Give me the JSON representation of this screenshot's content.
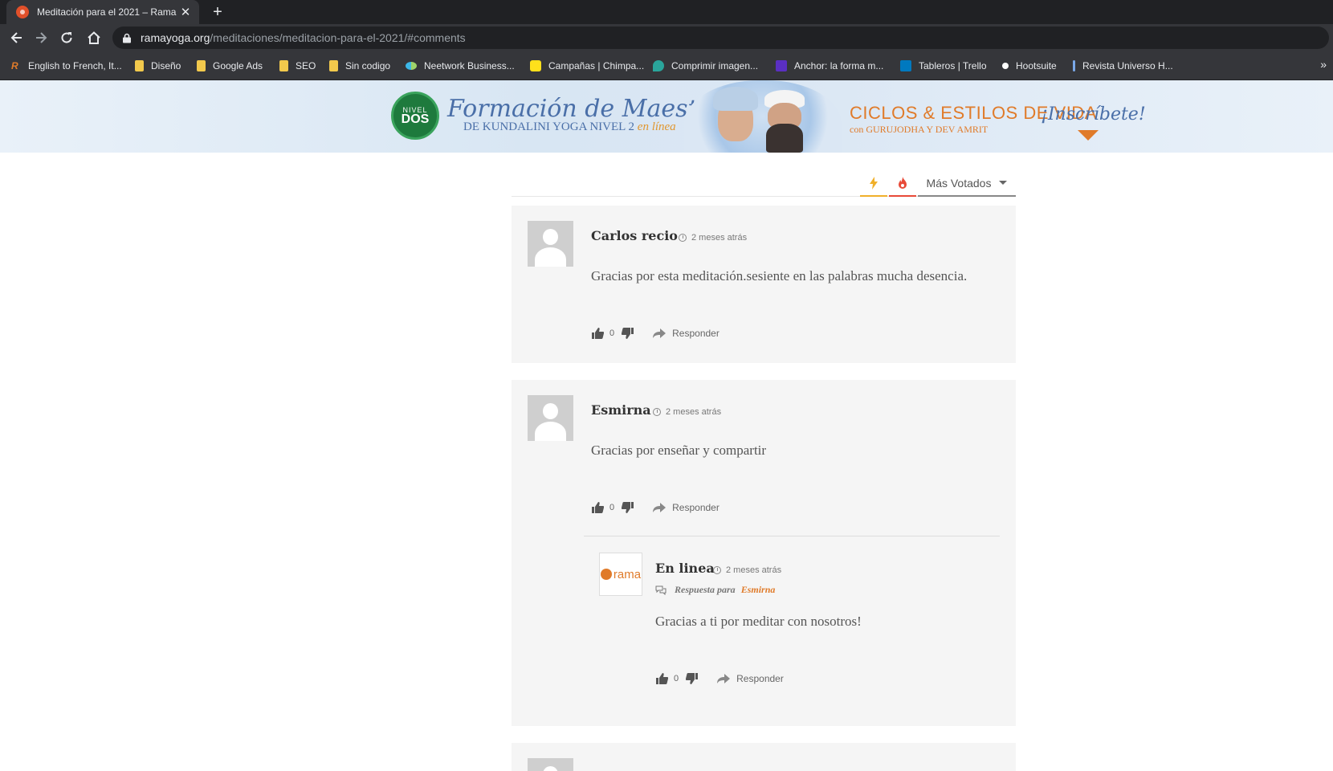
{
  "browser": {
    "tab_title": "Meditación para el 2021 – Rama",
    "tab_close": "✕",
    "new_tab": "+",
    "url_host": "ramayoga.org",
    "url_path": "/meditaciones/meditacion-para-el-2021/#comments",
    "bookmarks": [
      {
        "label": "English to French, It...",
        "icon": "reverso-icon"
      },
      {
        "label": "Diseño",
        "icon": "folder-icon"
      },
      {
        "label": "Google Ads",
        "icon": "folder-icon"
      },
      {
        "label": "SEO",
        "icon": "folder-icon"
      },
      {
        "label": "Sin codigo",
        "icon": "folder-icon"
      },
      {
        "label": "Neetwork Business...",
        "icon": "neetwork-icon"
      },
      {
        "label": "Campañas | Chimpa...",
        "icon": "mailchimp-icon"
      },
      {
        "label": "Comprimir imagen...",
        "icon": "compress-icon"
      },
      {
        "label": "Anchor: la forma m...",
        "icon": "anchor-icon"
      },
      {
        "label": "Tableros | Trello",
        "icon": "trello-icon"
      },
      {
        "label": "Hootsuite",
        "icon": "hootsuite-icon"
      },
      {
        "label": "Revista Universo H...",
        "icon": "revista-icon"
      }
    ],
    "bookmarks_more": "»"
  },
  "banner": {
    "badge_top": "NIVEL",
    "badge_bottom": "DOS",
    "title": "Formación de Maestros",
    "subtitle": "DE KUNDALINI YOGA NIVEL 2",
    "subtitle_em": "en línea",
    "ciclos": "CICLOS & ESTILOS DE VIDA",
    "ciclos_sub": "con GURUJODHA Y DEV AMRIT",
    "cta": "¡Inscríbete!",
    "colors": {
      "accent": "#e07b2a",
      "blue": "#4a6fa8",
      "green": "#1e7a3d"
    }
  },
  "comments": {
    "sort_label": "Más Votados",
    "items": [
      {
        "author": "Carlos recio",
        "time": "2 meses atrás",
        "text": "Gracias por esta meditación.sesiente en las palabras mucha desencia.",
        "votes": "0",
        "reply": "Responder"
      },
      {
        "author": "Esmirna",
        "time": "2 meses atrás",
        "text": "Gracias por enseñar y compartir",
        "votes": "0",
        "reply": "Responder",
        "child": {
          "author": "En linea",
          "time": "2 meses atrás",
          "reply_to_label": "Respuesta para",
          "reply_to_name": "Esmirna",
          "text": "Gracias a ti por meditar con nosotros!",
          "votes": "0",
          "reply": "Responder",
          "avatar_word": "rama"
        }
      }
    ]
  }
}
